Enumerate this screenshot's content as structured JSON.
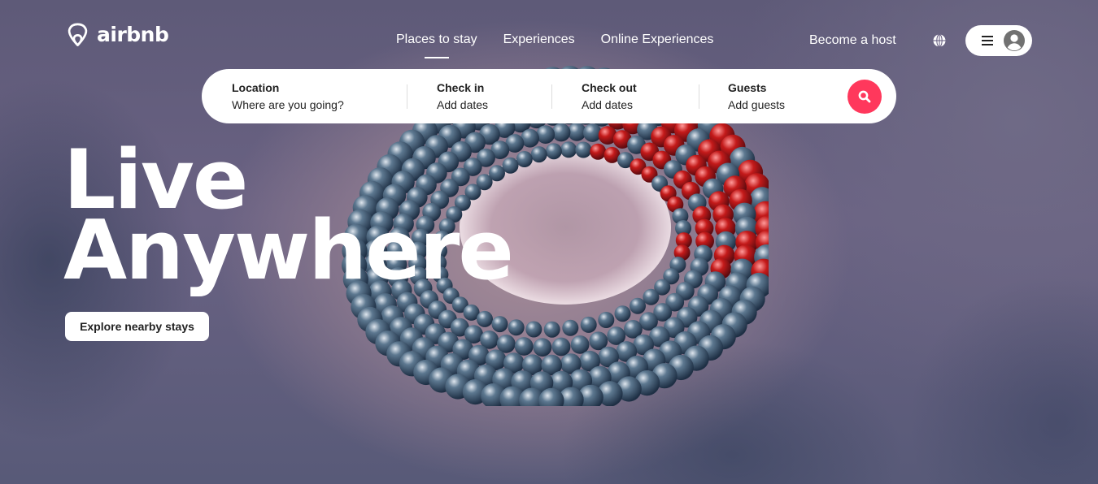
{
  "brand": {
    "name": "airbnb",
    "icon": "airbnb-logo-icon",
    "accent_color": "#ff385c"
  },
  "nav": {
    "items": [
      {
        "label": "Places to stay",
        "active": true
      },
      {
        "label": "Experiences",
        "active": false
      },
      {
        "label": "Online Experiences",
        "active": false
      }
    ]
  },
  "header": {
    "host_link": "Become a host",
    "globe_icon": "globe-icon",
    "menu_icon": "hamburger-menu-icon",
    "avatar_icon": "user-avatar-icon"
  },
  "search": {
    "location": {
      "label": "Location",
      "placeholder": "Where are you going?"
    },
    "check_in": {
      "label": "Check in",
      "value": "Add dates"
    },
    "check_out": {
      "label": "Check out",
      "value": "Add dates"
    },
    "guests": {
      "label": "Guests",
      "value": "Add guests"
    },
    "button_icon": "search-icon"
  },
  "hero": {
    "headline_line1": "Live",
    "headline_line2": "Anywhere",
    "cta_label": "Explore nearby stays"
  }
}
